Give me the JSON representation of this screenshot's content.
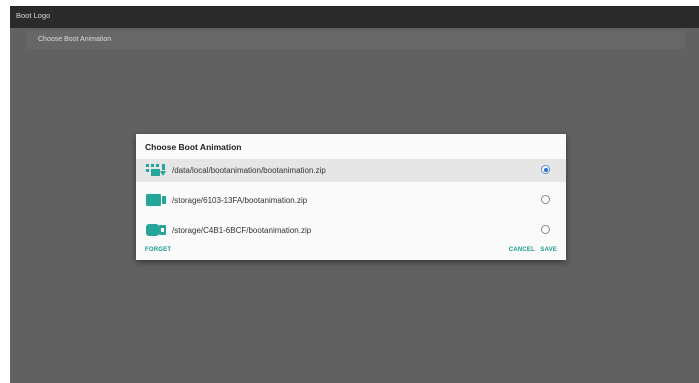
{
  "app": {
    "title": "Boot Logo"
  },
  "subheader": {
    "label": "Choose Boot Animation"
  },
  "dialog": {
    "title": "Choose Boot Animation",
    "options": [
      {
        "label": "/data/local/bootanimation/bootanimation.zip",
        "icon": "device-storage-icon",
        "selected": true
      },
      {
        "label": "/storage/6103-13FA/bootanimation.zip",
        "icon": "usb-drive-icon",
        "selected": false
      },
      {
        "label": "/storage/C4B1-6BCF/bootanimation.zip",
        "icon": "usb-drive-icon",
        "selected": false
      }
    ],
    "buttons": {
      "forget": "FORGET",
      "cancel": "CANCEL",
      "save": "SAVE"
    }
  },
  "colors": {
    "accent": "#1a9b8f",
    "icon": "#26a69a",
    "radio": "#2e6fc7"
  }
}
